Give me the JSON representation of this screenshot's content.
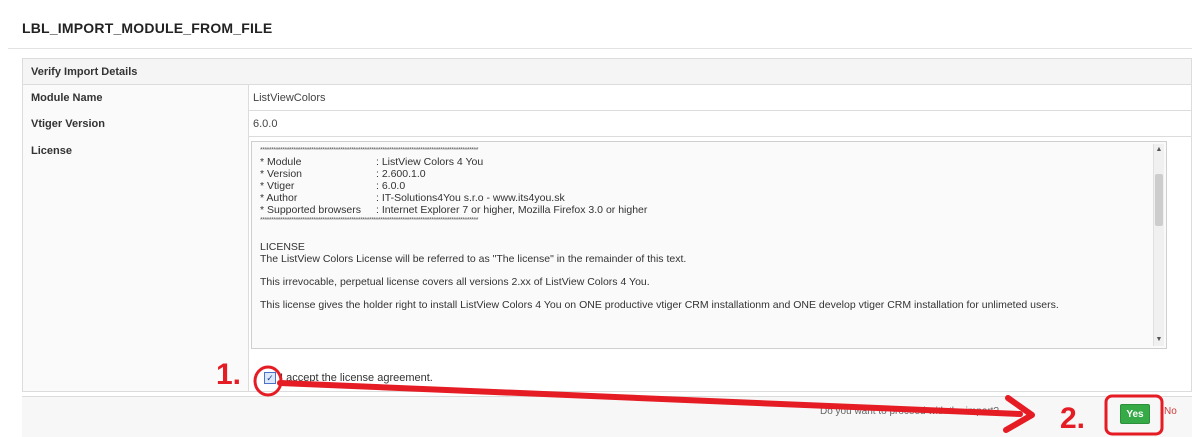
{
  "page": {
    "title": "LBL_IMPORT_MODULE_FROM_FILE"
  },
  "details": {
    "header": "Verify Import Details",
    "rows": [
      {
        "label": "Module Name",
        "value": "ListViewColors"
      },
      {
        "label": "Vtiger Version",
        "value": "6.0.0"
      }
    ],
    "license_label": "License"
  },
  "license": {
    "stars": "**************************************************************************************************",
    "fields": [
      {
        "key": "* Module",
        "value": ": ListView Colors 4 You"
      },
      {
        "key": "* Version",
        "value": ": 2.600.1.0"
      },
      {
        "key": "* Vtiger",
        "value": ": 6.0.0"
      },
      {
        "key": "* Author",
        "value": ": IT-Solutions4You s.r.o - www.its4you.sk"
      },
      {
        "key": "* Supported browsers",
        "value": ": Internet Explorer 7 or higher, Mozilla Firefox 3.0 or higher"
      }
    ],
    "heading": "LICENSE",
    "p1": "The ListView Colors License will be referred to as \"The license\" in the remainder of this text.",
    "p2": "This irrevocable, perpetual license covers all versions 2.xx of ListView Colors 4 You.",
    "p3": "This license gives the holder right to install ListView Colors 4 You on ONE productive vtiger CRM installationm and ONE develop vtiger CRM installation for unlimeted users."
  },
  "accept": {
    "label": "I accept the license agreement.",
    "checked": true
  },
  "footer": {
    "question": "Do you want to proceed with the import?",
    "yes_label": "Yes",
    "no_label": "No"
  },
  "annotations": {
    "step1": "1.",
    "step2": "2.",
    "color": "#e51c23"
  }
}
